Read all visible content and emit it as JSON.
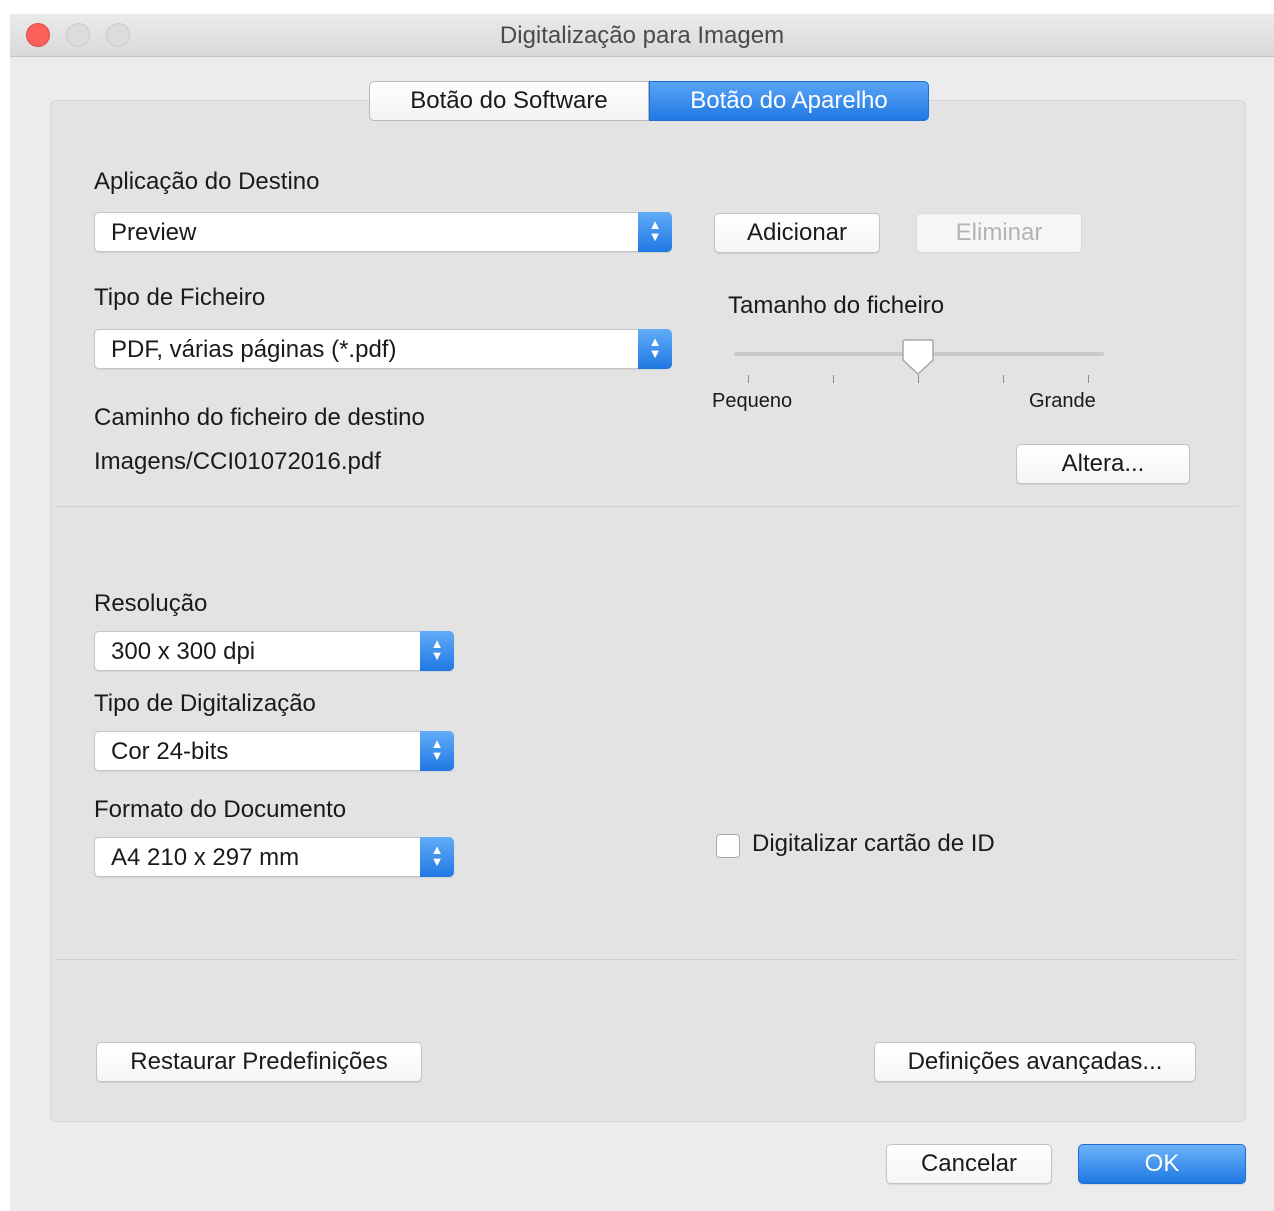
{
  "window": {
    "title": "Digitalização para Imagem"
  },
  "tabs": [
    {
      "label": "Botão do Software",
      "selected": false
    },
    {
      "label": "Botão do Aparelho",
      "selected": true
    }
  ],
  "destination": {
    "label": "Aplicação do Destino",
    "value": "Preview",
    "add_button": "Adicionar",
    "delete_button": "Eliminar"
  },
  "file_type": {
    "label": "Tipo de Ficheiro",
    "value": "PDF, várias páginas (*.pdf)"
  },
  "file_size": {
    "label": "Tamanho do ficheiro",
    "min_label": "Pequeno",
    "max_label": "Grande",
    "level": 0.5
  },
  "path": {
    "label": "Caminho do ficheiro de destino",
    "value": "Imagens/CCI01072016.pdf",
    "change_button": "Altera..."
  },
  "resolution": {
    "label": "Resolução",
    "value": "300 x 300 dpi"
  },
  "scan_type": {
    "label": "Tipo de Digitalização",
    "value": "Cor 24-bits"
  },
  "document_size": {
    "label": "Formato do Documento",
    "value": "A4 210 x 297 mm"
  },
  "id_card": {
    "label": "Digitalizar cartão de ID",
    "checked": false
  },
  "restore_button": "Restaurar Predefinições",
  "advanced_button": "Definições avançadas...",
  "cancel_button": "Cancelar",
  "ok_button": "OK",
  "colors": {
    "accent": "#1f78e2",
    "close": "#fc605b"
  }
}
